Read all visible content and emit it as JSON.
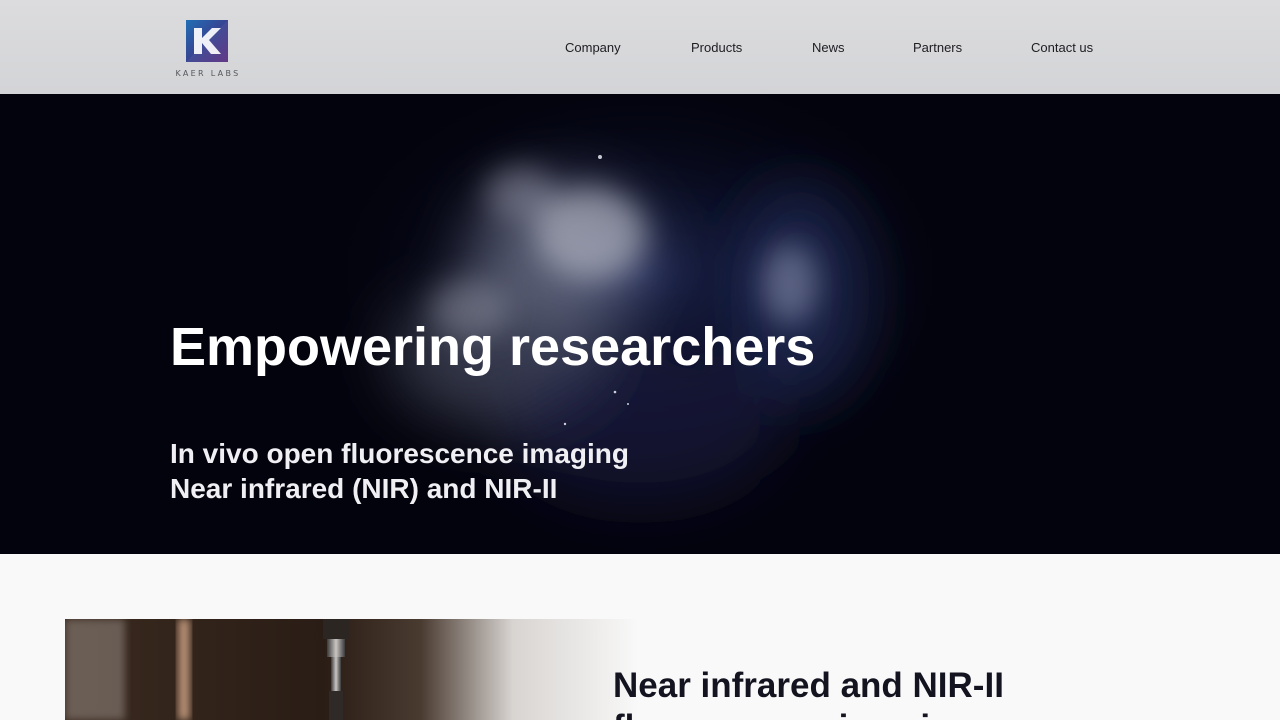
{
  "brand": {
    "name": "KAER LABS",
    "logo_letter": "K",
    "colors": {
      "blue": "#1f6fb5",
      "purple": "#5a2d7e"
    }
  },
  "nav": {
    "items": [
      {
        "label": "Company"
      },
      {
        "label": "Products"
      },
      {
        "label": "News"
      },
      {
        "label": "Partners"
      },
      {
        "label": "Contact us"
      }
    ]
  },
  "hero": {
    "title": "Empowering researchers",
    "subtitle_line1": "In vivo open fluorescence imaging",
    "subtitle_line2": "Near infrared (NIR) and NIR-II",
    "background_color": "#03030d"
  },
  "section": {
    "title_line1": "Near infrared and NIR-II",
    "title_line2": "fluorescence imaging"
  }
}
